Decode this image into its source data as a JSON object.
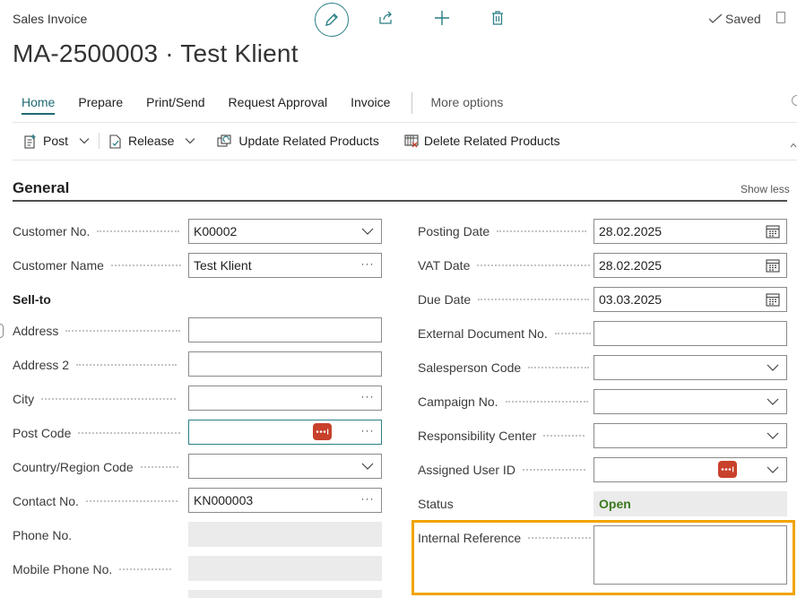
{
  "header": {
    "page_caption": "Sales Invoice",
    "title": "MA-2500003 · Test Klient",
    "saved_label": "Saved"
  },
  "tabs": [
    {
      "label": "Home",
      "active": true
    },
    {
      "label": "Prepare"
    },
    {
      "label": "Print/Send"
    },
    {
      "label": "Request Approval"
    },
    {
      "label": "Invoice"
    },
    {
      "label": "More options"
    }
  ],
  "actions": {
    "post": "Post",
    "release": "Release",
    "update_related": "Update Related Products",
    "delete_related": "Delete Related Products"
  },
  "section": {
    "title": "General",
    "show_less": "Show less",
    "sell_to": "Sell-to"
  },
  "left_fields": {
    "customer_no": {
      "label": "Customer No.",
      "value": "K00002"
    },
    "customer_name": {
      "label": "Customer Name",
      "value": "Test Klient"
    },
    "address": {
      "label": "Address",
      "value": ""
    },
    "address2": {
      "label": "Address 2",
      "value": ""
    },
    "city": {
      "label": "City",
      "value": ""
    },
    "post_code": {
      "label": "Post Code",
      "value": ""
    },
    "country": {
      "label": "Country/Region Code",
      "value": ""
    },
    "contact_no": {
      "label": "Contact No.",
      "value": "KN000003"
    },
    "phone_no": {
      "label": "Phone No.",
      "value": ""
    },
    "mobile_phone": {
      "label": "Mobile Phone No.",
      "value": ""
    }
  },
  "right_fields": {
    "posting_date": {
      "label": "Posting Date",
      "value": "28.02.2025"
    },
    "vat_date": {
      "label": "VAT Date",
      "value": "28.02.2025"
    },
    "due_date": {
      "label": "Due Date",
      "value": "03.03.2025"
    },
    "ext_doc_no": {
      "label": "External Document No.",
      "value": ""
    },
    "salesperson": {
      "label": "Salesperson Code",
      "value": ""
    },
    "campaign": {
      "label": "Campaign No.",
      "value": ""
    },
    "resp_center": {
      "label": "Responsibility Center",
      "value": ""
    },
    "assigned_user": {
      "label": "Assigned User ID",
      "value": ""
    },
    "status": {
      "label": "Status",
      "value": "Open"
    },
    "internal_ref": {
      "label": "Internal Reference",
      "value": ""
    }
  },
  "colors": {
    "accent": "#1f6a73",
    "status_green": "#3b7a1e",
    "highlight": "#f0a400",
    "badge_red": "#c8412b"
  }
}
